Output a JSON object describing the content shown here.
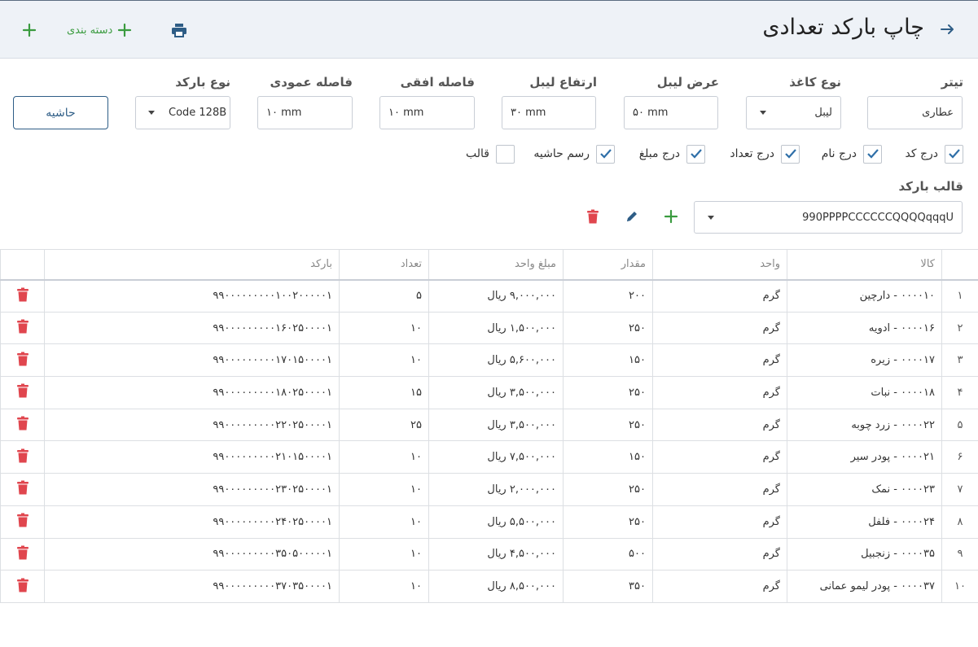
{
  "header": {
    "title": "چاپ بارکد تعدادی",
    "category_label": "دسته بندی",
    "icons": {
      "back": "arrow-right-icon",
      "print": "printer-icon",
      "add_category": "plus-icon",
      "add": "plus-icon"
    }
  },
  "form": {
    "title_field": {
      "label": "تیتر",
      "value": "عطاری"
    },
    "paper_type": {
      "label": "نوع کاغذ",
      "value": "لیبل"
    },
    "label_width": {
      "label": "عرض لیبل",
      "value": "۵۰ mm"
    },
    "label_height": {
      "label": "ارتفاع لیبل",
      "value": "۳۰ mm"
    },
    "h_gap": {
      "label": "فاصله افقی",
      "value": "۱۰ mm"
    },
    "v_gap": {
      "label": "فاصله عمودی",
      "value": "۱۰ mm"
    },
    "barcode_type": {
      "label": "نوع بارکد",
      "value": "Code 128B"
    },
    "border_button": "حاشیه"
  },
  "checkboxes": [
    {
      "label": "درج کد",
      "checked": true
    },
    {
      "label": "درج نام",
      "checked": true
    },
    {
      "label": "درج تعداد",
      "checked": true
    },
    {
      "label": "درج مبلغ",
      "checked": true
    },
    {
      "label": "رسم حاشیه",
      "checked": true
    },
    {
      "label": "قالب",
      "checked": false
    }
  ],
  "template": {
    "label": "قالب بارکد",
    "value": "990PPPPCCCCCCQQQQqqqU"
  },
  "table": {
    "columns": [
      "",
      "کالا",
      "واحد",
      "مقدار",
      "مبلغ واحد",
      "تعداد",
      "بارکد",
      ""
    ],
    "rows": [
      {
        "idx": "۱",
        "item": "۰۰۰۰۱۰ - دارچین",
        "unit": "گرم",
        "qty": "۲۰۰",
        "price": "۹,۰۰۰,۰۰۰ ریال",
        "count": "۵",
        "barcode": "۹۹۰۰۰۰۰۰۰۰۰۱۰۰۲۰۰۰۰۰۱"
      },
      {
        "idx": "۲",
        "item": "۰۰۰۰۱۶ - ادویه",
        "unit": "گرم",
        "qty": "۲۵۰",
        "price": "۱,۵۰۰,۰۰۰ ریال",
        "count": "۱۰",
        "barcode": "۹۹۰۰۰۰۰۰۰۰۰۱۶۰۲۵۰۰۰۰۱"
      },
      {
        "idx": "۳",
        "item": "۰۰۰۰۱۷ - زیره",
        "unit": "گرم",
        "qty": "۱۵۰",
        "price": "۵,۶۰۰,۰۰۰ ریال",
        "count": "۱۰",
        "barcode": "۹۹۰۰۰۰۰۰۰۰۰۱۷۰۱۵۰۰۰۰۱"
      },
      {
        "idx": "۴",
        "item": "۰۰۰۰۱۸ - نبات",
        "unit": "گرم",
        "qty": "۲۵۰",
        "price": "۳,۵۰۰,۰۰۰ ریال",
        "count": "۱۵",
        "barcode": "۹۹۰۰۰۰۰۰۰۰۰۱۸۰۲۵۰۰۰۰۱"
      },
      {
        "idx": "۵",
        "item": "۰۰۰۰۲۲ - زرد چوبه",
        "unit": "گرم",
        "qty": "۲۵۰",
        "price": "۳,۵۰۰,۰۰۰ ریال",
        "count": "۲۵",
        "barcode": "۹۹۰۰۰۰۰۰۰۰۰۲۲۰۲۵۰۰۰۰۱"
      },
      {
        "idx": "۶",
        "item": "۰۰۰۰۲۱ - پودر سیر",
        "unit": "گرم",
        "qty": "۱۵۰",
        "price": "۷,۵۰۰,۰۰۰ ریال",
        "count": "۱۰",
        "barcode": "۹۹۰۰۰۰۰۰۰۰۰۲۱۰۱۵۰۰۰۰۱"
      },
      {
        "idx": "۷",
        "item": "۰۰۰۰۲۳ - نمک",
        "unit": "گرم",
        "qty": "۲۵۰",
        "price": "۲,۰۰۰,۰۰۰ ریال",
        "count": "۱۰",
        "barcode": "۹۹۰۰۰۰۰۰۰۰۰۲۳۰۲۵۰۰۰۰۱"
      },
      {
        "idx": "۸",
        "item": "۰۰۰۰۲۴ - فلفل",
        "unit": "گرم",
        "qty": "۲۵۰",
        "price": "۵,۵۰۰,۰۰۰ ریال",
        "count": "۱۰",
        "barcode": "۹۹۰۰۰۰۰۰۰۰۰۲۴۰۲۵۰۰۰۰۱"
      },
      {
        "idx": "۹",
        "item": "۰۰۰۰۳۵ - زنجبیل",
        "unit": "گرم",
        "qty": "۵۰۰",
        "price": "۴,۵۰۰,۰۰۰ ریال",
        "count": "۱۰",
        "barcode": "۹۹۰۰۰۰۰۰۰۰۰۳۵۰۵۰۰۰۰۰۱"
      },
      {
        "idx": "۱۰",
        "item": "۰۰۰۰۳۷ - پودر لیمو عمانی",
        "unit": "گرم",
        "qty": "۳۵۰",
        "price": "۸,۵۰۰,۰۰۰ ریال",
        "count": "۱۰",
        "barcode": "۹۹۰۰۰۰۰۰۰۰۰۳۷۰۳۵۰۰۰۰۱"
      }
    ],
    "row_action_icon": "trash-icon"
  },
  "colors": {
    "accent_blue": "#2e5d86",
    "add_green": "#3a9b3f",
    "delete_red": "#e0464e",
    "check_blue": "#2f6fa8"
  }
}
